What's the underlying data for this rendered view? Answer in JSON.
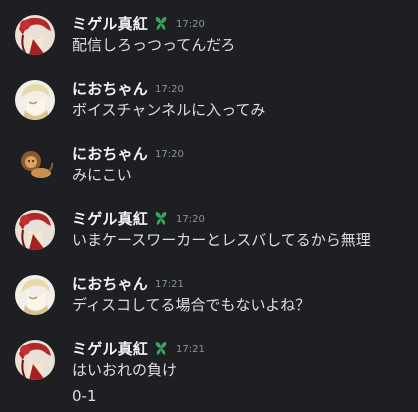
{
  "colors": {
    "background": "#1e1f22",
    "username": "#f2f3f5",
    "text": "#dcdee1",
    "timestamp": "#8e9297",
    "badge": "#3ba55c"
  },
  "messages": [
    {
      "author": "ミゲル真紅",
      "avatar_icon": "red-haired-character-avatar-icon",
      "badge_icon": "green-leaf-badge-icon",
      "time": "17:20",
      "lines": [
        "配信しろっつってんだろ"
      ]
    },
    {
      "author": "におちゃん",
      "avatar_icon": "blonde-character-avatar-icon",
      "time": "17:20",
      "lines": [
        "ボイスチャンネルに入ってみ"
      ]
    },
    {
      "author": "におちゃん",
      "avatar_icon": "lion-avatar-icon",
      "time": "17:20",
      "lines": [
        "みにこい"
      ]
    },
    {
      "author": "ミゲル真紅",
      "avatar_icon": "red-haired-character-avatar-icon",
      "badge_icon": "green-leaf-badge-icon",
      "time": "17:20",
      "lines": [
        "いまケースワーカーとレスバしてるから無理"
      ]
    },
    {
      "author": "におちゃん",
      "avatar_icon": "blonde-character-avatar-icon",
      "time": "17:21",
      "lines": [
        "ディスコしてる場合でもないよね？"
      ]
    },
    {
      "author": "ミゲル真紅",
      "avatar_icon": "red-haired-character-avatar-icon",
      "badge_icon": "green-leaf-badge-icon",
      "time": "17:21",
      "lines": [
        "はいおれの負け",
        "0-1"
      ]
    }
  ]
}
